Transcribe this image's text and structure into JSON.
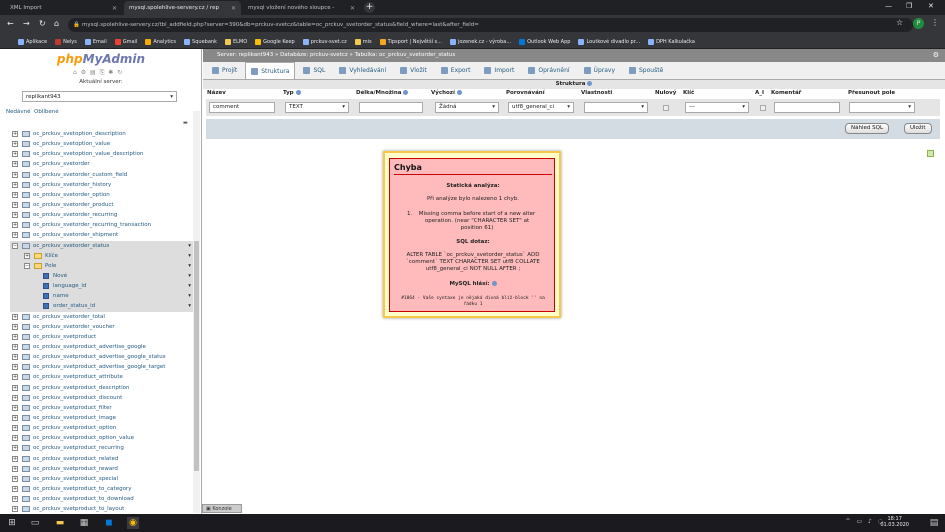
{
  "browser": {
    "tabs": [
      {
        "title": "XML Import"
      },
      {
        "title": "mysql.spolehlive-servery.cz / rep"
      },
      {
        "title": "mysql vložení nového sloupce -"
      }
    ],
    "url": "mysql.spolehlive-servery.cz/tbl_addfield.php?server=390&db=prckuv-svetcz&table=oc_prckuv_svetorder_status&field_where=last&after_field=",
    "profile_initial": "P",
    "bookmarks": [
      "Aplikace",
      "Nelys",
      "Email",
      "Gmail",
      "Analytics",
      "Squebank",
      "ELMO",
      "Google Keep",
      "prckuv-svet.cz",
      "mis",
      "Tipsport | Největší s...",
      "jozenek.cz - výroba...",
      "Outlook Web App",
      "Loutkové divadlo pr...",
      "DPH Kalkulačka"
    ]
  },
  "sidebar": {
    "logo_php": "php",
    "logo_myadmin": "MyAdmin",
    "server_label": "Aktuální server:",
    "server_value": "replikant943",
    "recent": "Nedávné",
    "favorites": "Oblíbené",
    "tree": [
      "oc_prckuv_svetoption_description",
      "oc_prckuv_svetoption_value",
      "oc_prckuv_svetoption_value_description",
      "oc_prckuv_svetorder",
      "oc_prckuv_svetorder_custom_field",
      "oc_prckuv_svetorder_history",
      "oc_prckuv_svetorder_option",
      "oc_prckuv_svetorder_product",
      "oc_prckuv_svetorder_recurring",
      "oc_prckuv_svetorder_recurring_transaction",
      "oc_prckuv_svetorder_shipment",
      "oc_prckuv_svetorder_status"
    ],
    "status_children": {
      "keys": "Klíče",
      "fields": "Pole",
      "new": "Nové",
      "field_list": [
        "language_id",
        "name",
        "order_status_id"
      ]
    },
    "tree_after": [
      "oc_prckuv_svetorder_total",
      "oc_prckuv_svetorder_voucher",
      "oc_prckuv_svetproduct",
      "oc_prckuv_svetproduct_advertise_google",
      "oc_prckuv_svetproduct_advertise_google_status",
      "oc_prckuv_svetproduct_advertise_google_target",
      "oc_prckuv_svetproduct_attribute",
      "oc_prckuv_svetproduct_description",
      "oc_prckuv_svetproduct_discount",
      "oc_prckuv_svetproduct_filter",
      "oc_prckuv_svetproduct_image",
      "oc_prckuv_svetproduct_option",
      "oc_prckuv_svetproduct_option_value",
      "oc_prckuv_svetproduct_recurring",
      "oc_prckuv_svetproduct_related",
      "oc_prckuv_svetproduct_reward",
      "oc_prckuv_svetproduct_special",
      "oc_prckuv_svetproduct_to_category",
      "oc_prckuv_svetproduct_to_download",
      "oc_prckuv_svetproduct_to_layout"
    ]
  },
  "main": {
    "breadcrumb": "Server: replikant943 » Databáze: prckuv-svetcz » Tabulka: oc_prckuv_svetorder_status",
    "menu": [
      {
        "label": "Projít",
        "active": false
      },
      {
        "label": "Struktura",
        "active": true
      },
      {
        "label": "SQL",
        "active": false
      },
      {
        "label": "Vyhledávání",
        "active": false
      },
      {
        "label": "Vložit",
        "active": false
      },
      {
        "label": "Export",
        "active": false
      },
      {
        "label": "Import",
        "active": false
      },
      {
        "label": "Oprávnění",
        "active": false
      },
      {
        "label": "Úpravy",
        "active": false
      },
      {
        "label": "Spouště",
        "active": false
      }
    ],
    "structure_title": "Struktura",
    "headers": {
      "name": "Název",
      "type": "Typ",
      "length": "Délka/Množina",
      "default": "Výchozí",
      "collation": "Porovnávání",
      "attributes": "Vlastnosti",
      "null": "Nulový",
      "key": "Klíč",
      "ai": "A_I",
      "comment": "Komentář",
      "move": "Přesunout pole"
    },
    "row": {
      "name": "comment",
      "type": "TEXT",
      "length": "",
      "default": "Žádná",
      "collation": "utf8_general_ci",
      "attributes": "",
      "key": "---",
      "comment": "",
      "move": ""
    },
    "buttons": {
      "preview_sql": "Náhled SQL",
      "save": "Uložit"
    },
    "console": "Konzole"
  },
  "dialog": {
    "title": "Chyba",
    "static_analysis": "Statická analýza:",
    "found": "Při analýze bylo nalezeno 1 chyb.",
    "error_num": "1.",
    "error_text": "Missing comma before start of a new alter operation. (near \"CHARACTER SET\" at position 61)",
    "sql_label": "SQL dotaz:",
    "sql": "ALTER TABLE `oc_prckuv_svetorder_status` ADD `comment` TEXT CHARACTER SET utf8 COLLATE utf8_general_ci NOT NULL AFTER ;",
    "mysql_label": "MySQL hlásí:",
    "mysql_msg": "#1064 - Vaše syntaxe je nějaká divná blíž-block '' na řádku 1"
  },
  "taskbar": {
    "time": "18:17",
    "date": "01.03.2020"
  }
}
